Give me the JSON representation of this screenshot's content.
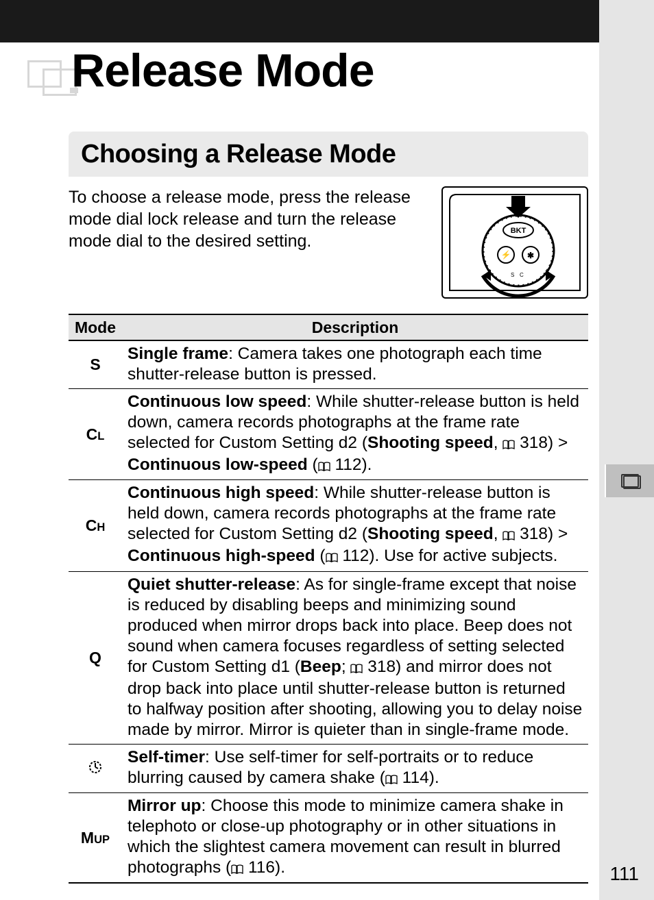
{
  "chapter_title": "Release Mode",
  "subheading": "Choosing a Release Mode",
  "intro": "To choose a release mode, press the release mode dial lock release and turn the release mode dial to the desired setting.",
  "table": {
    "headers": {
      "mode": "Mode",
      "description": "Description"
    },
    "rows": [
      {
        "mode": "S",
        "title": "Single frame",
        "rest": ": Camera takes one photograph each time shutter-release button is pressed."
      },
      {
        "mode_html": "C<span class=\"sup\">L</span>",
        "title": "Continuous low speed",
        "pre": ": While shutter-release button is held down, camera records photographs at the frame rate selected for Custom Setting d2 (",
        "b1": "Shooting speed",
        "mid1": ", ",
        "ref1": "318",
        "mid2": ") > ",
        "b2": "Continuous low-speed",
        "post": " (",
        "ref2": "112",
        "tail": ")."
      },
      {
        "mode_html": "C<span class=\"sup\">H</span>",
        "title": "Continuous high speed",
        "pre": ": While shutter-release button is held down, camera records photographs at the frame rate selected for Custom Setting d2 (",
        "b1": "Shooting speed",
        "mid1": ", ",
        "ref1": "318",
        "mid2": ") > ",
        "b2": "Continuous high-speed",
        "post": " (",
        "ref2": "112",
        "tail": "). Use for active subjects."
      },
      {
        "mode": "Q",
        "title": "Quiet shutter-release",
        "pre": ": As for single-frame except that noise is reduced by disabling beeps and minimizing sound produced when mirror drops back into place.  Beep does not sound when camera focuses regardless of setting selected for Custom Setting d1 (",
        "b1": "Beep",
        "mid1": "; ",
        "ref1": "318",
        "tail": ") and mirror does not drop back into place until shutter-release button is returned to halfway position after shooting, allowing you to delay noise made by mirror.  Mirror is quieter than in single-frame mode."
      },
      {
        "mode_icon": "self-timer",
        "title": "Self-timer",
        "pre": ": Use self-timer for self-portraits or to reduce blurring caused by camera shake (",
        "ref1": "114",
        "tail": ")."
      },
      {
        "mode_html": "M<span class=\"sup\">UP</span>",
        "title": "Mirror up",
        "pre": ": Choose this mode to minimize camera shake in telephoto or close-up photography or in other situations in which the slightest camera movement can result in blurred photographs (",
        "ref1": "116",
        "tail": ")."
      }
    ]
  },
  "diagram_label": "BKT",
  "page_number": "111"
}
